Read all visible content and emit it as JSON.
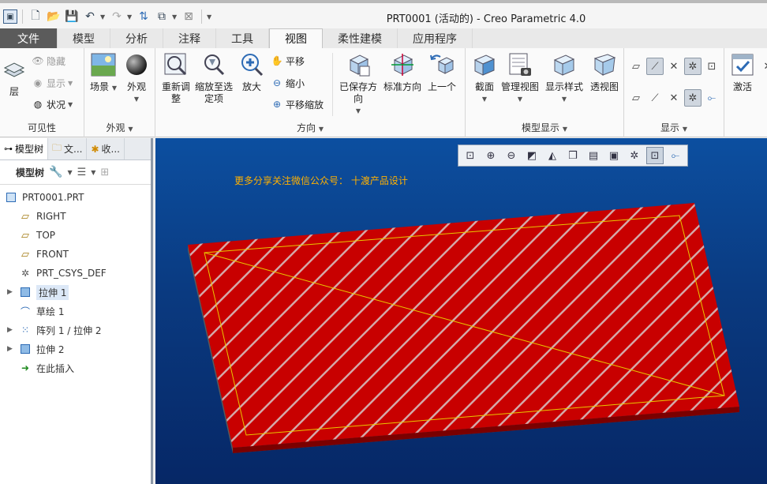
{
  "window": {
    "title": "PRT0001 (活动的) - Creo Parametric 4.0"
  },
  "quick_access": {
    "icons": [
      "app-icon",
      "new-icon",
      "open-icon",
      "save-icon",
      "undo-icon",
      "redo-icon",
      "regenerate-icon",
      "window-icon",
      "close-window-icon",
      "customize-icon"
    ]
  },
  "tabs": [
    {
      "label": "文件"
    },
    {
      "label": "模型"
    },
    {
      "label": "分析"
    },
    {
      "label": "注释"
    },
    {
      "label": "工具"
    },
    {
      "label": "视图"
    },
    {
      "label": "柔性建模"
    },
    {
      "label": "应用程序"
    }
  ],
  "ribbon": {
    "visibility": {
      "label": "可见性",
      "layer": "层",
      "hide": "隐藏",
      "show": "显示",
      "status": "状况"
    },
    "appearance": {
      "label": "外观",
      "scene": "场景",
      "appearance": "外观"
    },
    "orientation": {
      "label": "方向",
      "refit": "重新调整",
      "zoom_to_selected": "缩放至选定项",
      "zoom_in": "放大",
      "pan": "平移",
      "zoom_out": "缩小",
      "pan_zoom": "平移缩放",
      "saved_orientations": "已保存方向",
      "standard_orientation": "标准方向",
      "previous": "上一个"
    },
    "model_display": {
      "label": "模型显示",
      "section": "截面",
      "manage_views": "管理视图",
      "display_style": "显示样式",
      "perspective": "透视图"
    },
    "show": {
      "label": "显示"
    },
    "activate": {
      "label": "激活"
    }
  },
  "left_panel": {
    "tabs": [
      {
        "label": "模型树"
      },
      {
        "label": "文..."
      },
      {
        "label": "收..."
      }
    ],
    "toolbar_label": "模型树",
    "tree": [
      {
        "label": "PRT0001.PRT",
        "icon": "part-icon",
        "expandable": false,
        "indent": 0
      },
      {
        "label": "RIGHT",
        "icon": "datum-plane-icon",
        "expandable": false,
        "indent": 1
      },
      {
        "label": "TOP",
        "icon": "datum-plane-icon",
        "expandable": false,
        "indent": 1
      },
      {
        "label": "FRONT",
        "icon": "datum-plane-icon",
        "expandable": false,
        "indent": 1
      },
      {
        "label": "PRT_CSYS_DEF",
        "icon": "csys-icon",
        "expandable": false,
        "indent": 1
      },
      {
        "label": "拉伸 1",
        "icon": "extrude-icon",
        "expandable": true,
        "indent": 1,
        "highlight": true
      },
      {
        "label": "草绘 1",
        "icon": "sketch-icon",
        "expandable": false,
        "indent": 1
      },
      {
        "label": "阵列 1 / 拉伸 2",
        "icon": "pattern-icon",
        "expandable": true,
        "indent": 1
      },
      {
        "label": "拉伸 2",
        "icon": "extrude-icon",
        "expandable": true,
        "indent": 1
      },
      {
        "label": "在此插入",
        "icon": "insert-here-icon",
        "expandable": false,
        "indent": 1
      }
    ]
  },
  "viewport": {
    "watermark": "更多分享关注微信公众号： 十渡产品设计",
    "colors": {
      "top_face": "#c80000",
      "side_face": "#7a0000",
      "bottom_edge": "#5a5a5a",
      "hatch": "#d4a8a8",
      "sketch_line": "#e8c800"
    }
  }
}
